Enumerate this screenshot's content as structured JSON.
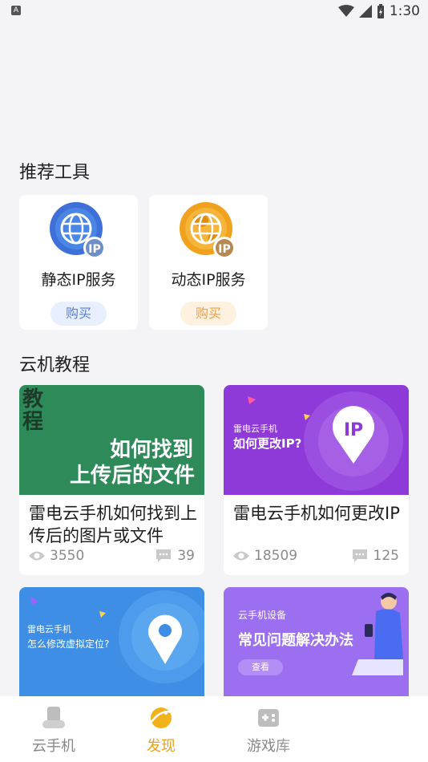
{
  "status_bar": {
    "time": "1:30",
    "notification_letter": "A"
  },
  "recommended_tools": {
    "title": "推荐工具",
    "items": [
      {
        "name": "静态IP服务",
        "button": "购买",
        "icon": "globe-ip-blue-icon",
        "color": "#3f7fe0"
      },
      {
        "name": "动态IP服务",
        "button": "购买",
        "icon": "globe-ip-orange-icon",
        "color": "#f0a21e"
      }
    ]
  },
  "tutorials": {
    "title": "云机教程",
    "items": [
      {
        "title": "雷电云手机如何找到上传后的图片或文件",
        "views": "3550",
        "comments": "39",
        "thumb": {
          "tag": "教程",
          "line1": "如何找到",
          "line2": "上传后的文件",
          "bg": "#2f8a5a"
        }
      },
      {
        "title": "雷电云手机如何更改IP",
        "views": "18509",
        "comments": "125",
        "thumb": {
          "brand": "雷电云手机",
          "headline": "如何更改IP?",
          "badge": "IP",
          "bg": "#8d3ad8"
        }
      },
      {
        "thumb": {
          "brand": "雷电云手机",
          "headline": "怎么修改虚拟定位?",
          "bg": "#3f8ee6"
        }
      },
      {
        "thumb": {
          "brand": "云手机设备",
          "headline": "常见问题解决办法",
          "button": "查看",
          "bg": "#9b6ff0"
        }
      }
    ]
  },
  "bottom_nav": {
    "items": [
      {
        "label": "云手机",
        "icon": "cloud-phone-icon",
        "active": false
      },
      {
        "label": "发现",
        "icon": "discover-planet-icon",
        "active": true
      },
      {
        "label": "游戏库",
        "icon": "gamepad-icon",
        "active": false
      }
    ],
    "accent": "#e9a21a"
  }
}
